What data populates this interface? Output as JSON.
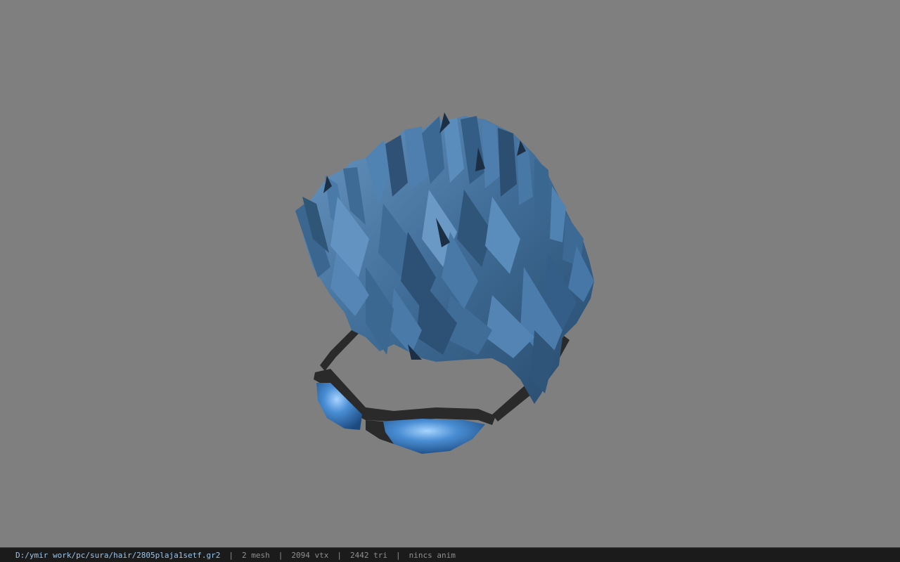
{
  "viewport": {
    "background_color": "#7f7f7f",
    "model": {
      "subject": "blue-spiky-hair-with-sunglasses",
      "hair_color": "#3f6c96",
      "hair_dark_color": "#1c2f44",
      "hair_light_color": "#6f9cc6",
      "glasses_frame_color": "#2a2a2a",
      "lens_color": "#3c7fc2"
    }
  },
  "statusbar": {
    "file_path": "D:/ymir work/pc/sura/hair/2805plaja1setf.gr2",
    "separator": "|",
    "mesh_count": "2 mesh",
    "vertex_count": "2094 vtx",
    "triangle_count": "2442 tri",
    "animation": "nincs anim",
    "path_color": "#9fc3e6",
    "text_color": "#8f8f8f",
    "background_color": "#1b1b1b"
  }
}
